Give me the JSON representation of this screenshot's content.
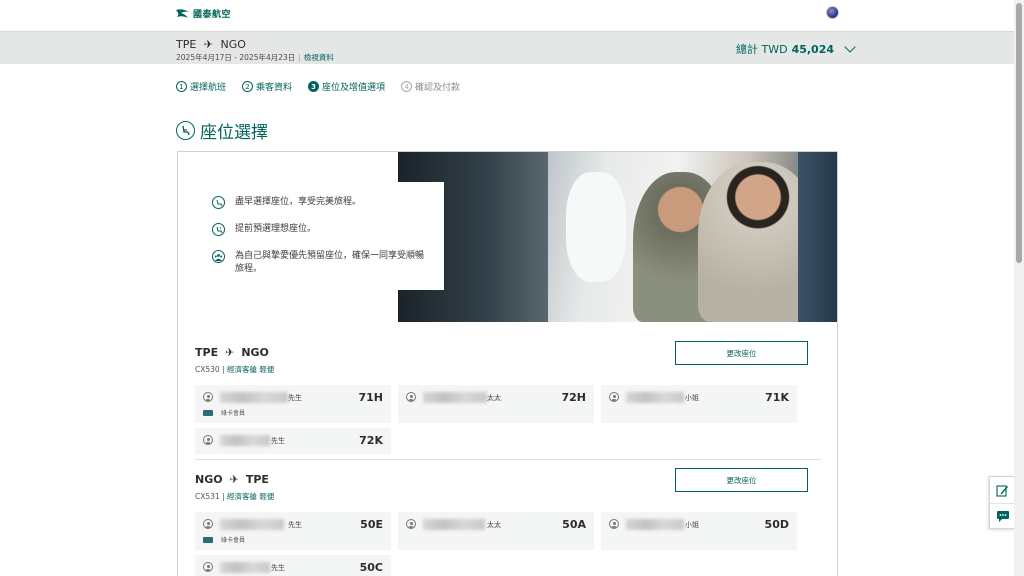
{
  "header": {
    "logo_text": "國泰航空"
  },
  "trip": {
    "origin": "TPE",
    "destination": "NGO",
    "dates": "2025年4月17日 - 2025年4月23日",
    "details_link": "檢視資料",
    "total_label": "總計 TWD",
    "total_amount": "45,024"
  },
  "steps": [
    {
      "num": "1",
      "label": "選擇航班"
    },
    {
      "num": "2",
      "label": "乘客資料"
    },
    {
      "num": "3",
      "label": "座位及增值選項"
    },
    {
      "num": "4",
      "label": "確認及付款"
    }
  ],
  "page_title": "座位選擇",
  "promo": [
    {
      "text": "盡早選擇座位，享受完美旅程。",
      "icon": "seat-icon"
    },
    {
      "text": "提前預選理想座位。",
      "icon": "seat-window-icon"
    },
    {
      "text": "為自己與摯愛優先預留座位，確保一同享受順暢旅程。",
      "icon": "group-icon"
    }
  ],
  "flights": [
    {
      "origin": "TPE",
      "destination": "NGO",
      "flight_no": "CX530",
      "cabin": "經濟客艙 輕便",
      "change_label": "更改座位",
      "passengers": [
        {
          "title": "先生",
          "seat": "71H",
          "member": "綠卡會員"
        },
        {
          "title": "太太",
          "seat": "72H"
        },
        {
          "title": "小姐",
          "seat": "71K"
        },
        {
          "title": "先生",
          "seat": "72K"
        }
      ]
    },
    {
      "origin": "NGO",
      "destination": "TPE",
      "flight_no": "CX531",
      "cabin": "經濟客艙 輕便",
      "change_label": "更改座位",
      "passengers": [
        {
          "title": "先生",
          "seat": "50E",
          "member": "綠卡會員"
        },
        {
          "title": "太太",
          "seat": "50A"
        },
        {
          "title": "小姐",
          "seat": "50D"
        },
        {
          "title": "先生",
          "seat": "50C"
        }
      ]
    }
  ],
  "colors": {
    "brand": "#00645a",
    "trip_bar": "#e5e6e6",
    "pax_bg": "#f4f5f5"
  }
}
